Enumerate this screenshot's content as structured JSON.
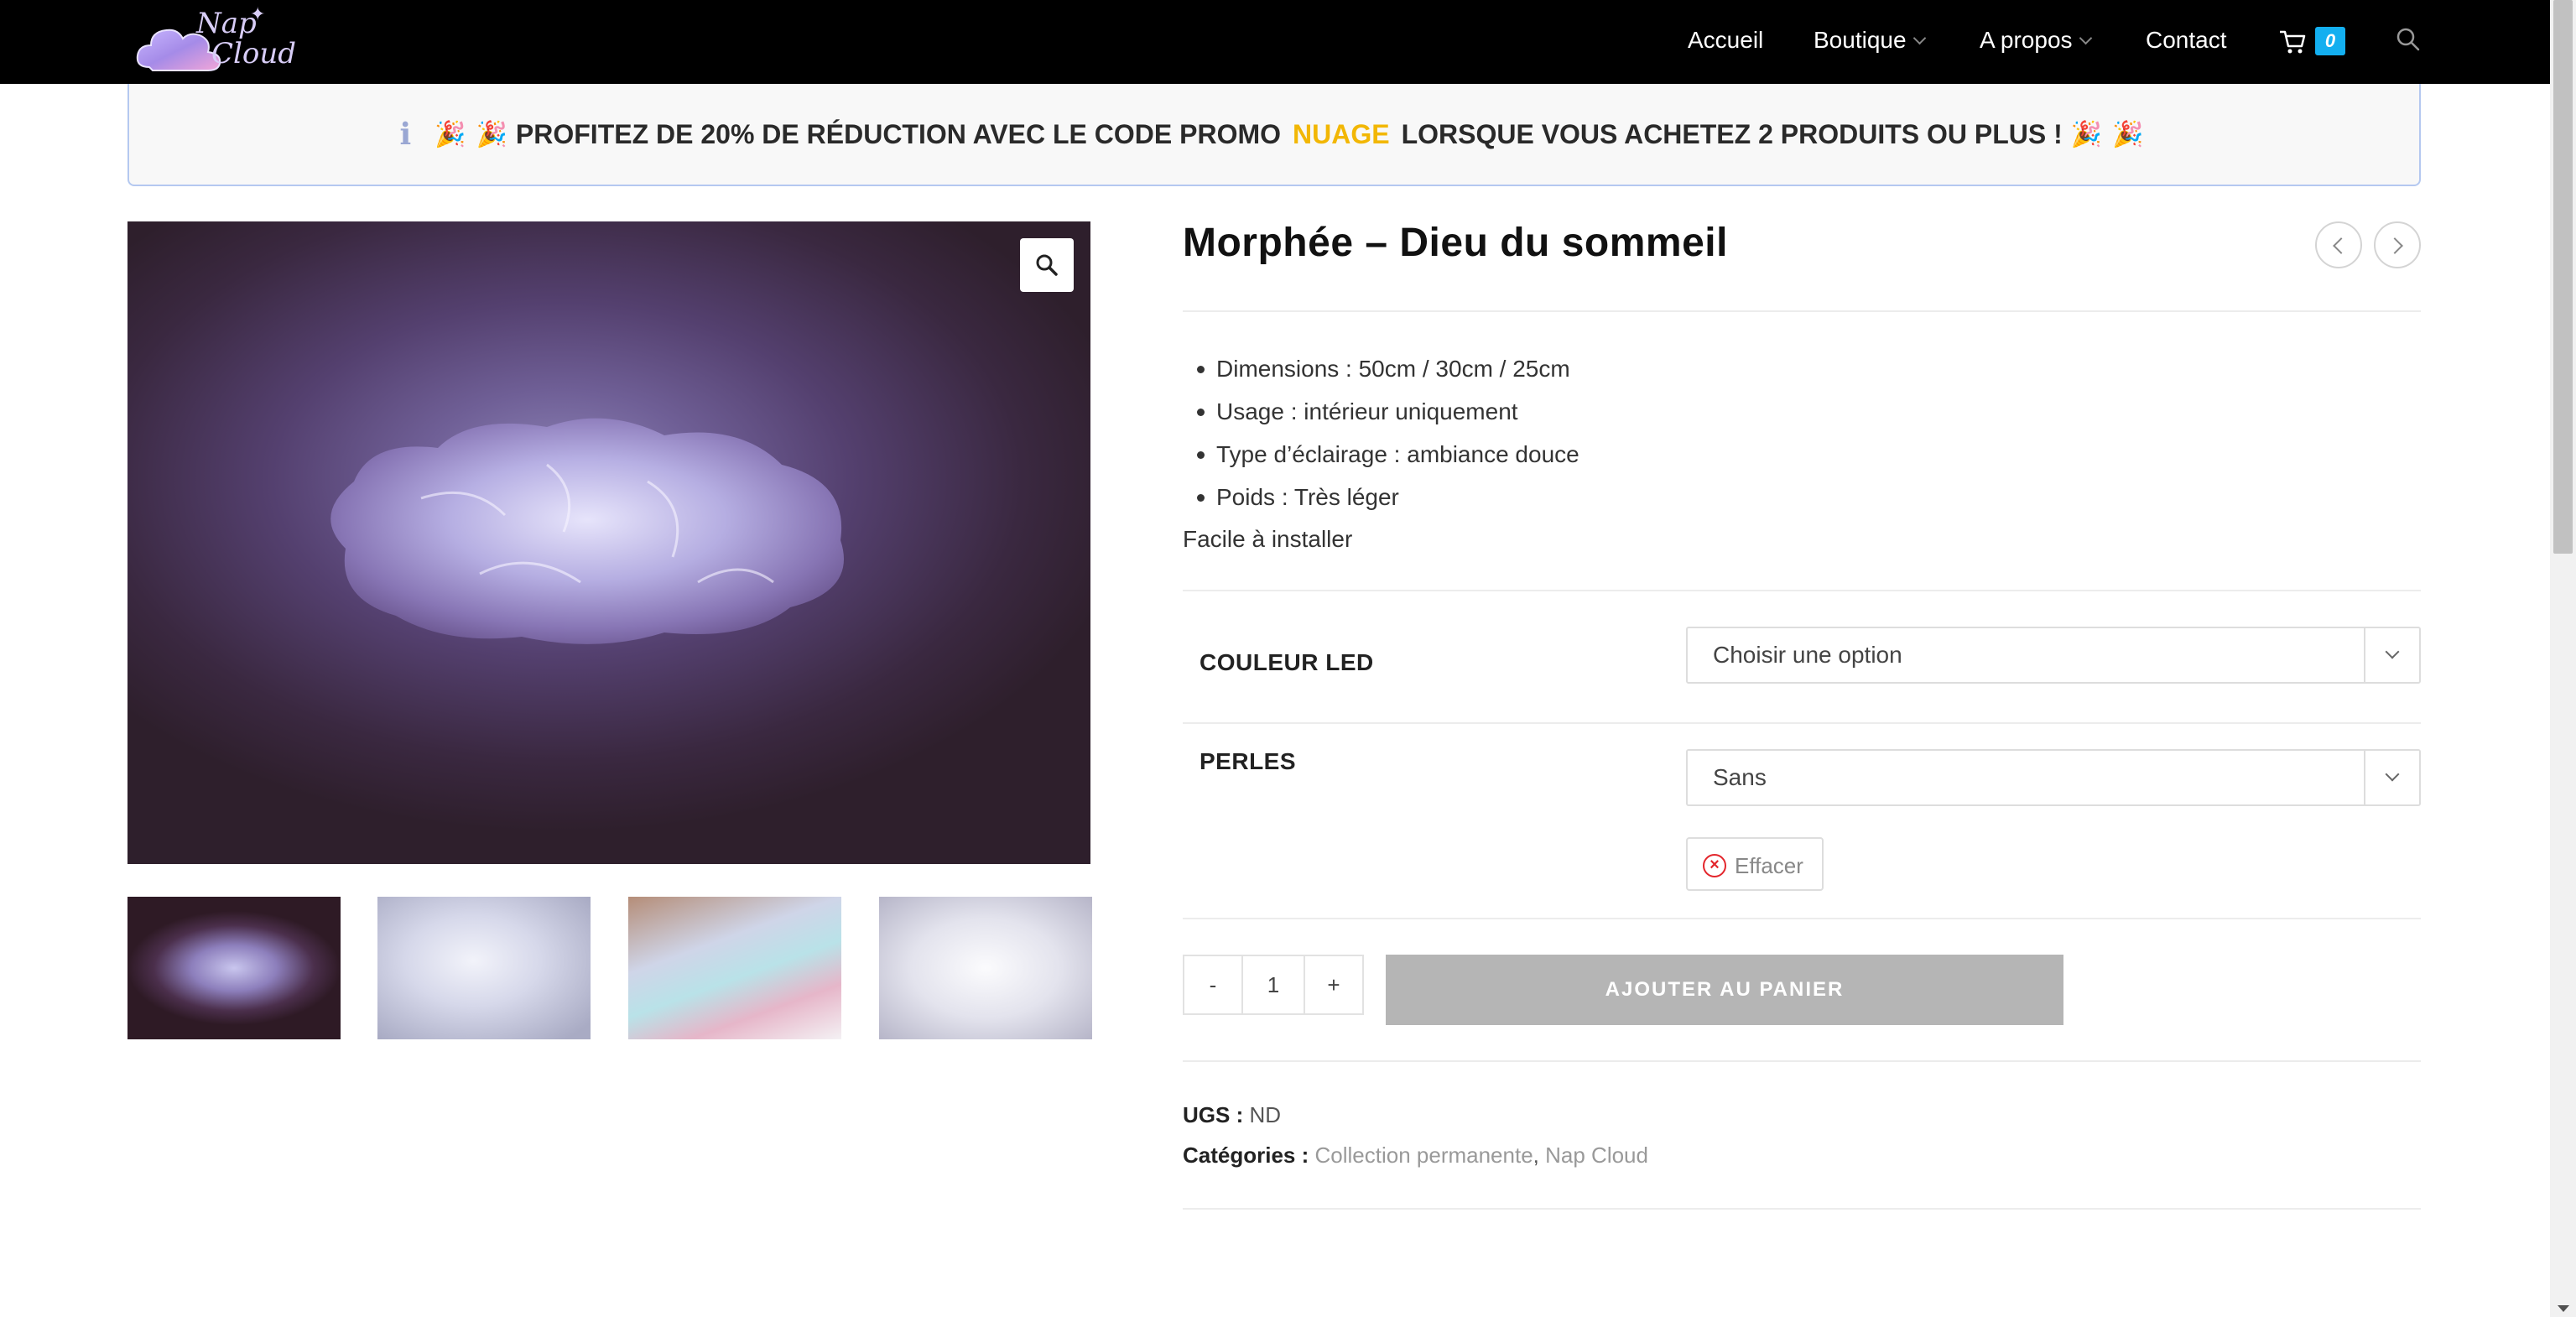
{
  "brand": {
    "logo_line1": "Nap",
    "logo_line2": "Cloud",
    "logo_sparkle": "✦"
  },
  "nav": {
    "items": [
      {
        "label": "Accueil",
        "has_dropdown": false
      },
      {
        "label": "Boutique",
        "has_dropdown": true
      },
      {
        "label": "A propos",
        "has_dropdown": true
      },
      {
        "label": "Contact",
        "has_dropdown": false
      }
    ],
    "cart_count": "0",
    "cart_icon": "cart-icon",
    "search_icon": "search-icon"
  },
  "promo": {
    "info_icon": "ℹ",
    "emoji": "🎉",
    "text_before": "PROFITEZ DE 20% DE RÉDUCTION AVEC LE CODE PROMO",
    "code": "NUAGE",
    "text_after": "LORSQUE VOUS ACHETEZ 2 PRODUITS OU PLUS !",
    "code_color": "#f2b705"
  },
  "gallery": {
    "zoom_icon": "magnifier-icon",
    "thumbnail_count": 4
  },
  "product": {
    "title": "Morphée – Dieu du sommeil",
    "features": [
      "Dimensions : 50cm / 30cm / 25cm",
      "Usage : intérieur uniquement",
      "Type d’éclairage : ambiance douce",
      "Poids : Très léger"
    ],
    "extra_note": "Facile à installer",
    "variations": {
      "led_label": "COULEUR LED",
      "led_value": "Choisir une option",
      "beads_label": "PERLES",
      "beads_value": "Sans",
      "clear_label": "Effacer"
    },
    "quantity": {
      "minus": "-",
      "value": "1",
      "plus": "+"
    },
    "add_to_cart": "AJOUTER AU PANIER",
    "meta": {
      "sku_label": "UGS :",
      "sku_value": "ND",
      "categories_label": "Catégories :",
      "categories": [
        "Collection permanente",
        "Nap Cloud"
      ],
      "separator": ","
    }
  },
  "colors": {
    "accent": "#13aff0",
    "header_bg": "#000000",
    "button_disabled": "#b5b5b5"
  }
}
